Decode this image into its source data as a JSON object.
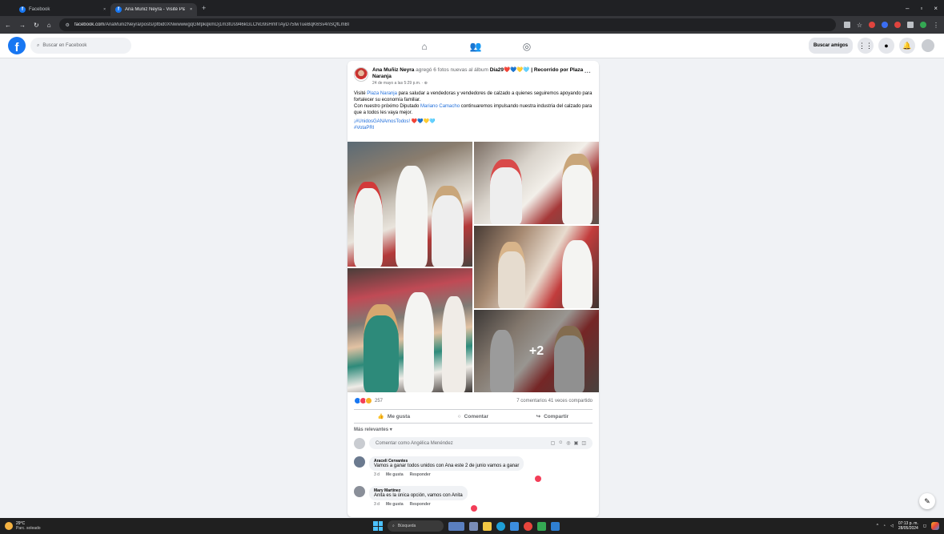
{
  "browser": {
    "tabs": [
      {
        "title": "Facebook",
        "active": false
      },
      {
        "title": "Ana Muñiz Neyra - Visité Plaza",
        "active": true
      }
    ],
    "url_host": "facebook.com",
    "url_path": "/AnaMunizNeyra/posts/pfbid0XNwwwwgqGMpkqkmDj1m3tUs946kGLCNG9sHmfTAyD75twTueBqK6Sv4nSQfLmBl"
  },
  "fb": {
    "search_placeholder": "Buscar en Facebook",
    "find_friends": "Buscar amigos"
  },
  "post": {
    "author": "Ana Muñiz Neyra",
    "action": " agregó 6 fotos nuevas al álbum ",
    "album": "Día29❤️💙💛🩵 | Recorrido por Plaza Naranja",
    "date": "24 de mayo a las 5:29 p.m. · ⊕",
    "text_1a": "Visité ",
    "text_1_link": "Plaza Naranja",
    "text_1b": " para saludar a vendedoras y vendedores de calzado a quienes seguiremos apoyando para fortalecer su economía familiar.",
    "text_2a": "Con nuestro próximo Diputado ",
    "text_2_link": "Mariano Camacho",
    "text_2b": " continuaremos impulsando nuestra industria del calzado para que a todos les vaya mejor.",
    "hashtag_1": "¡#UnidosGANAmosTodos! ❤️💙💛🩵",
    "hashtag_2": "#VotaPRI",
    "more_photos": "+2",
    "reaction_count": "257",
    "comments_shares": "7 comentarios  41 veces compartido",
    "like": "Me gusta",
    "comment": "Comentar",
    "share": "Compartir",
    "sort": "Más relevantes",
    "comment_placeholder": "Comentar como Angélica Menéndez"
  },
  "comments": [
    {
      "name": "Araceli Cervantes",
      "text": "Vamos a ganar todos unidos con Ana este 2 de junio vamos a ganar",
      "age": "3 d",
      "like": "Me gusta",
      "reply": "Responder"
    },
    {
      "name": "Mary Martínez",
      "text": "Anita es la única opción, vamos con Anita",
      "age": "3 d",
      "like": "Me gusta",
      "reply": "Responder"
    }
  ],
  "taskbar": {
    "temp": "29°C",
    "weather": "Parc. soleado",
    "search": "Búsqueda",
    "time": "07:13 p. m.",
    "date": "28/05/2024"
  },
  "colors": {
    "fb_blue": "#1877f2",
    "link": "#216fdb",
    "background": "#f0f2f5"
  }
}
